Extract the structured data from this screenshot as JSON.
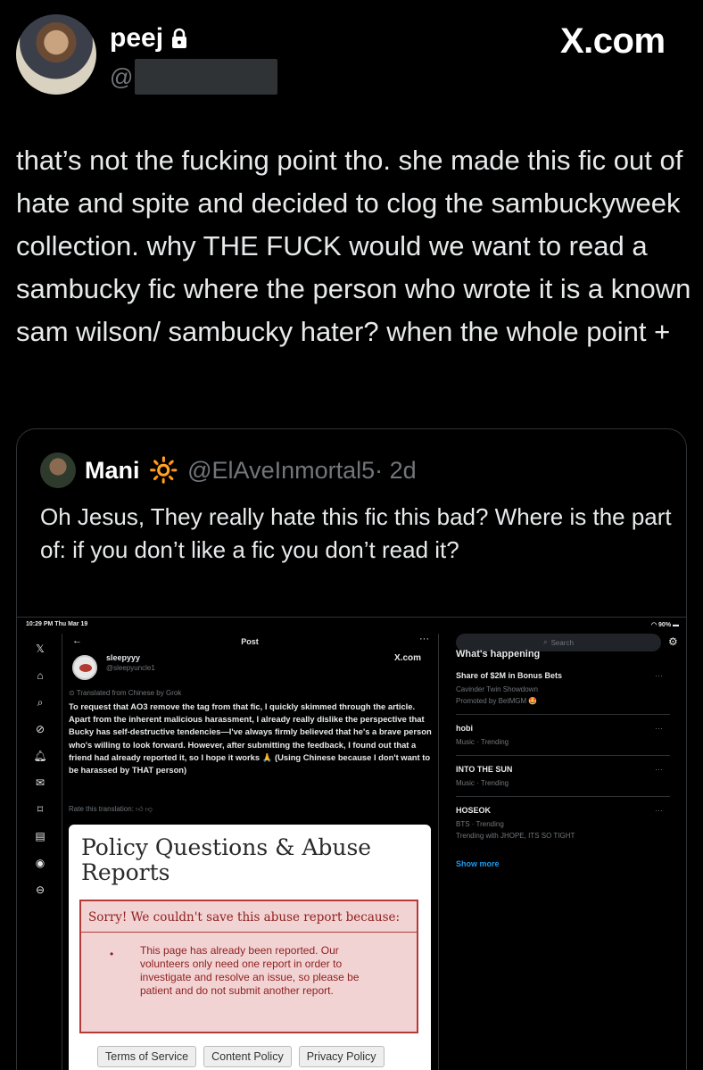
{
  "tweet": {
    "display_name": "peej",
    "handle_prefix": "@",
    "brand": "X.com",
    "text": "that’s not the fucking point tho. she made this fic out of hate and spite and decided to clog the sambuckyweek collection. why THE FUCK would we want to read a sambucky fic where the person who wrote it is a known sam wilson/ sambucky hater? when the whole point +"
  },
  "quote": {
    "name": "Mani",
    "emoji": "🔆",
    "handle": "@ElAveInmortal5",
    "time": "· 2d",
    "text": "Oh Jesus, They really hate this fic this bad? Where is the part of: if you don’t like a fic you don’t read it?"
  },
  "screenshot": {
    "status_time": "10:29 PM  Thu Mar 19",
    "status_battery": "90%",
    "post_title": "Post",
    "author_name": "sleepyyy",
    "author_handle": "@sleepyuncle1",
    "brand": "X.com",
    "translated_label": "Translated from Chinese by Grok",
    "body": "To request that AO3 remove the tag from that fic, I quickly skimmed through the article. Apart from the inherent malicious harassment, I already really dislike the perspective that Bucky has self-destructive tendencies—I've always firmly believed that he's a brave person who's willing to look forward. However, after submitting the feedback, I found out that a friend had already reported it, so I hope it works 🙏 (Using Chinese because I don't want to be harassed by THAT person)",
    "rate_label": "Rate this translation:",
    "ao3": {
      "title": "Policy Questions & Abuse Reports",
      "error_heading": "Sorry! We couldn't save this abuse report because:",
      "error_body": "This page has already been reported. Our volunteers only need one report in order to investigate and resolve an issue, so please be patient and do not submit another report.",
      "footer_buttons": [
        "Terms of Service",
        "Content Policy",
        "Privacy Policy"
      ]
    },
    "search_placeholder": "Search",
    "trends_title": "What's happening",
    "trends": [
      {
        "title": "Share of $2M in Bonus Bets",
        "meta1": "Cavinder Twin Showdown",
        "meta2": "Promoted by BetMGM 🤩"
      },
      {
        "title": "hobi",
        "meta1": "Music · Trending",
        "meta2": ""
      },
      {
        "title": "INTO THE SUN",
        "meta1": "Music · Trending",
        "meta2": ""
      },
      {
        "title": "HOSEOK",
        "meta1": "BTS · Trending",
        "meta2": "Trending with JHOPE, ITS SO TIGHT"
      }
    ],
    "show_more": "Show more"
  }
}
